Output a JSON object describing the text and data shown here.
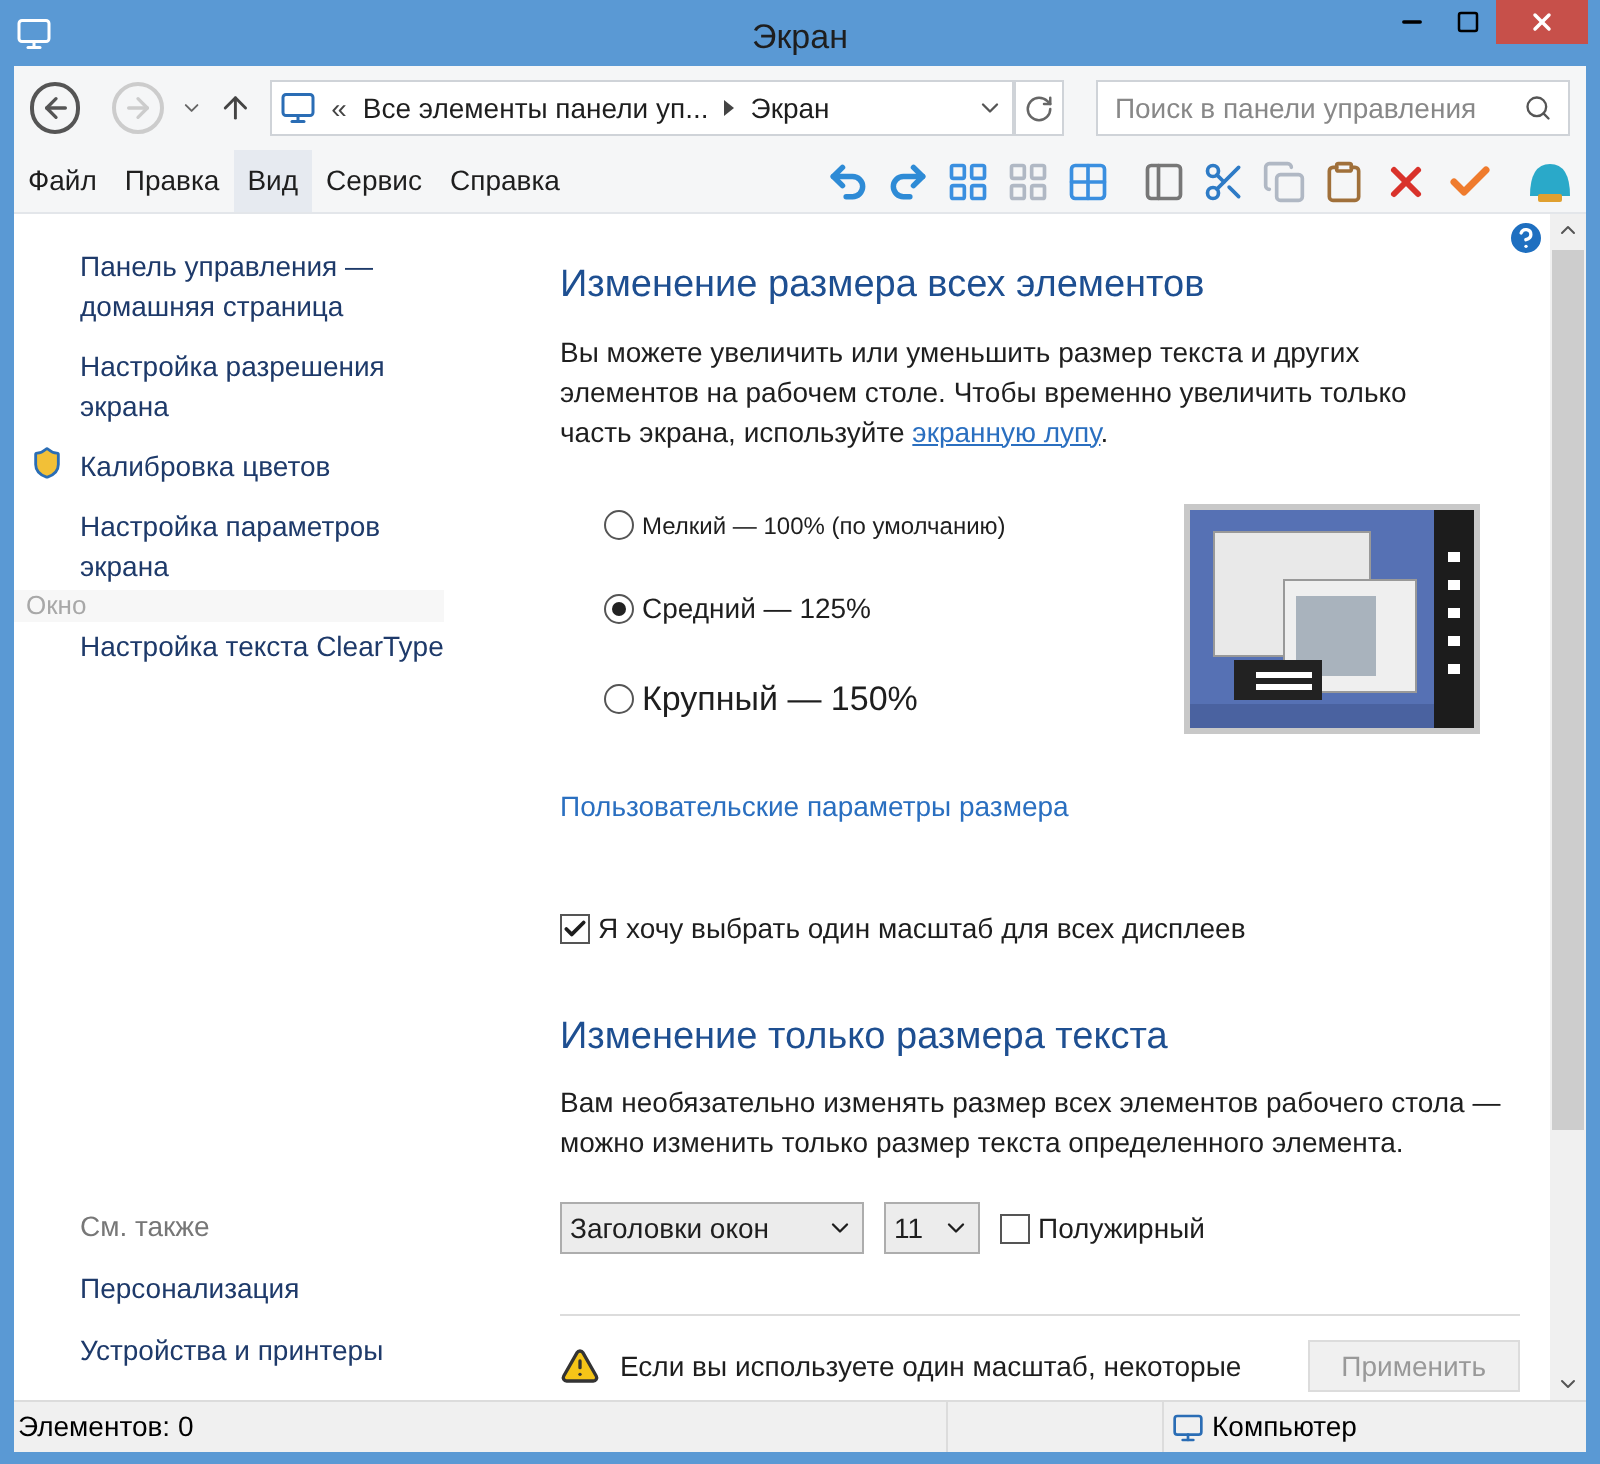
{
  "window": {
    "title": "Экран"
  },
  "address": {
    "breadcrumbs": [
      "«",
      "Все элементы панели уп...",
      "Экран"
    ]
  },
  "search": {
    "placeholder": "Поиск в панели управления"
  },
  "menu": [
    {
      "label": "Файл",
      "selected": false
    },
    {
      "label": "Правка",
      "selected": false
    },
    {
      "label": "Вид",
      "selected": true
    },
    {
      "label": "Сервис",
      "selected": false
    },
    {
      "label": "Справка",
      "selected": false
    }
  ],
  "toolbar": [
    {
      "kind": "undo",
      "disabled": false
    },
    {
      "kind": "redo",
      "disabled": false
    },
    {
      "kind": "grid",
      "disabled": false
    },
    {
      "kind": "grid",
      "disabled": true
    },
    {
      "kind": "grid-mixed",
      "disabled": false
    },
    {
      "kind": "panel",
      "disabled": false
    },
    {
      "kind": "cut",
      "disabled": false
    },
    {
      "kind": "copy",
      "disabled": true
    },
    {
      "kind": "paste",
      "disabled": false
    },
    {
      "kind": "delete",
      "disabled": false
    },
    {
      "kind": "check",
      "disabled": false
    },
    {
      "kind": "shell",
      "disabled": false
    }
  ],
  "sidebar": {
    "items": [
      {
        "label": "Панель управления — домашняя страница",
        "kind": "link"
      },
      {
        "label": "Настройка разрешения экрана",
        "kind": "link"
      },
      {
        "label": "Калибровка цветов",
        "kind": "shield"
      },
      {
        "label": "Настройка параметров экрана",
        "kind": "link"
      },
      {
        "label": "Настройка текста ClearType",
        "kind": "link"
      }
    ],
    "ghost_label": "Окно",
    "see_also": "См. также",
    "see_also_items": [
      "Персонализация",
      "Устройства и принтеры"
    ]
  },
  "section1": {
    "heading": "Изменение размера всех элементов",
    "text": "Вы можете увеличить или уменьшить размер текста и других элементов на рабочем столе. Чтобы временно увеличить только часть экрана, используйте ",
    "link": "экранную лупу",
    "text_end": ".",
    "options": [
      {
        "label": "Мелкий — 100% (по умолчанию)",
        "selected": false
      },
      {
        "label": "Средний — 125%",
        "selected": true
      },
      {
        "label": "Крупный — 150%",
        "selected": false
      }
    ],
    "custom_link": "Пользовательские параметры размера",
    "one_scale": {
      "label": "Я хочу выбрать один масштаб для всех дисплеев",
      "checked": true
    }
  },
  "section2": {
    "heading": "Изменение только размера текста",
    "text": "Вам необязательно изменять размер всех элементов рабочего стола — можно изменить только размер текста определенного элемента.",
    "element_select": "Заголовки окон",
    "size_select": "11",
    "bold": {
      "label": "Полужирный",
      "checked": false
    }
  },
  "warning": "Если вы используете один масштаб, некоторые",
  "apply_button": {
    "label": "Применить",
    "disabled": true
  },
  "status_bar": {
    "items": "Элементов: 0",
    "zone": "Компьютер"
  }
}
